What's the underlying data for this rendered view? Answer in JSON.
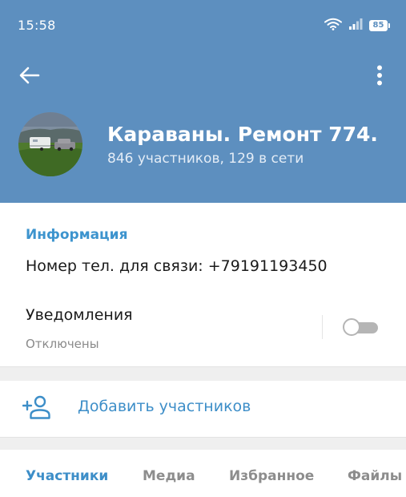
{
  "status_bar": {
    "time": "15:58",
    "battery": "85"
  },
  "header": {
    "title": "Караваны. Ремонт 774.",
    "subtitle": "846 участников, 129 в сети"
  },
  "info": {
    "section_title": "Информация",
    "phone_line": "Номер тел. для связи: +79191193450",
    "notifications_label": "Уведомления",
    "notifications_status": "Отключены",
    "notifications_enabled": false
  },
  "actions": {
    "add_members": "Добавить участников"
  },
  "tabs": [
    {
      "label": "Участники",
      "active": true
    },
    {
      "label": "Медиа",
      "active": false
    },
    {
      "label": "Избранное",
      "active": false
    },
    {
      "label": "Файлы",
      "active": false
    }
  ],
  "colors": {
    "header_bg": "#5d8fbf",
    "accent": "#3d8ec8",
    "section_gap": "#efefef"
  }
}
